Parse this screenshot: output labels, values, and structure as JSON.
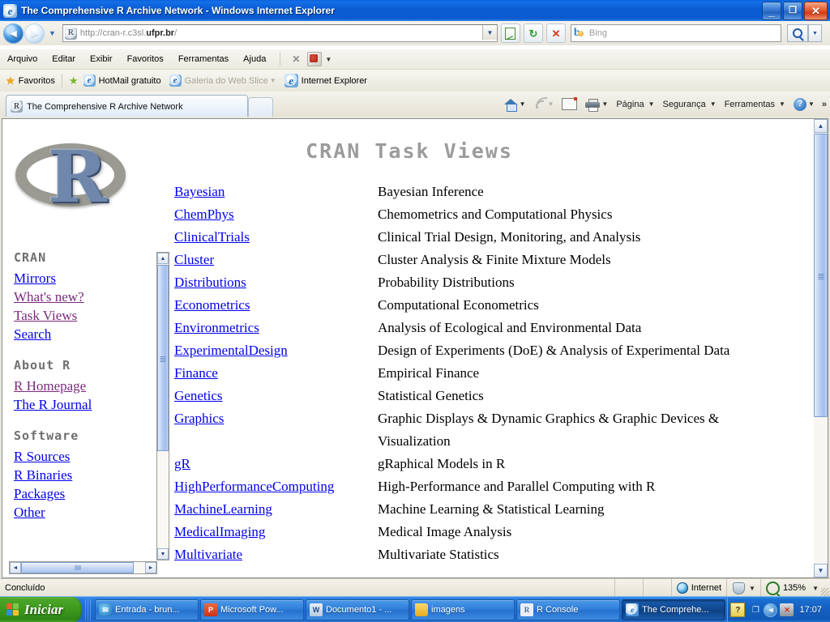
{
  "window": {
    "title": "The Comprehensive R Archive Network - Windows Internet Explorer",
    "app_icon": "internet-explorer-icon",
    "minimize": "_",
    "restore": "❐",
    "close": "✕"
  },
  "navbar": {
    "back_glyph": "◄",
    "forward_glyph": "►",
    "history_glyph": "▼",
    "address_value_prefix": "http://cran-r.c3sl.",
    "address_value_bold": "ufpr.br",
    "address_value_suffix": "/",
    "address_dropdown_glyph": "▼",
    "compat_icon": "compatibility-view-icon",
    "refresh_icon": "↻",
    "stop_icon": "✕",
    "search_engine": "Bing",
    "search_go_glyph": "🔍",
    "search_dropdown_glyph": "▼"
  },
  "menubar": {
    "items": [
      "Arquivo",
      "Editar",
      "Exibir",
      "Favoritos",
      "Ferramentas",
      "Ajuda"
    ],
    "close_x": "✕",
    "pdf_dropdown_glyph": "▼"
  },
  "favbar": {
    "favorites_label": "Favoritos",
    "add_glyph": "★",
    "items": [
      {
        "label": "HotMail gratuito",
        "dim": false,
        "dropdown": false
      },
      {
        "label": "Galeria do Web Slice",
        "dim": true,
        "dropdown": true
      },
      {
        "label": "Internet Explorer",
        "dim": false,
        "dropdown": false
      }
    ]
  },
  "tabs": {
    "active_tab_label": "The Comprehensive R Archive Network",
    "tab_icon": "r-site-icon",
    "new_tab_label": ""
  },
  "commandbar": {
    "home_label": "",
    "feeds_label": "",
    "mail_label": "",
    "print_label": "",
    "items": [
      "Página",
      "Segurança",
      "Ferramentas"
    ],
    "help_glyph": "?",
    "overflow_glyph": "»",
    "dropdown_glyph": "▼"
  },
  "page": {
    "logo_letter": "R",
    "sidebar": [
      {
        "heading": "CRAN",
        "links": [
          {
            "label": "Mirrors",
            "visited": false
          },
          {
            "label": "What's new?",
            "visited": true
          },
          {
            "label": "Task Views",
            "visited": true
          },
          {
            "label": "Search",
            "visited": false
          }
        ]
      },
      {
        "heading": "About R",
        "links": [
          {
            "label": "R Homepage",
            "visited": true
          },
          {
            "label": "The R Journal",
            "visited": false
          }
        ]
      },
      {
        "heading": "Software",
        "links": [
          {
            "label": "R Sources",
            "visited": false
          },
          {
            "label": "R Binaries",
            "visited": false
          },
          {
            "label": "Packages",
            "visited": false
          },
          {
            "label": "Other",
            "visited": false
          }
        ]
      }
    ],
    "title": "CRAN Task Views",
    "task_views": [
      {
        "name": "Bayesian",
        "description": "Bayesian Inference"
      },
      {
        "name": "ChemPhys",
        "description": "Chemometrics and Computational Physics"
      },
      {
        "name": "ClinicalTrials",
        "description": "Clinical Trial Design, Monitoring, and Analysis"
      },
      {
        "name": "Cluster",
        "description": "Cluster Analysis & Finite Mixture Models"
      },
      {
        "name": "Distributions",
        "description": "Probability Distributions"
      },
      {
        "name": "Econometrics",
        "description": "Computational Econometrics"
      },
      {
        "name": "Environmetrics",
        "description": "Analysis of Ecological and Environmental Data"
      },
      {
        "name": "ExperimentalDesign",
        "description": "Design of Experiments (DoE) & Analysis of Experimental Data"
      },
      {
        "name": "Finance",
        "description": "Empirical Finance"
      },
      {
        "name": "Genetics",
        "description": "Statistical Genetics"
      },
      {
        "name": "Graphics",
        "description": "Graphic Displays & Dynamic Graphics & Graphic Devices & Visualization"
      },
      {
        "name": "gR",
        "description": "gRaphical Models in R"
      },
      {
        "name": "HighPerformanceComputing",
        "description": "High-Performance and Parallel Computing with R"
      },
      {
        "name": "MachineLearning",
        "description": "Machine Learning & Statistical Learning"
      },
      {
        "name": "MedicalImaging",
        "description": "Medical Image Analysis"
      },
      {
        "name": "Multivariate",
        "description": "Multivariate Statistics"
      }
    ]
  },
  "statusbar": {
    "status": "Concluído",
    "zone": "Internet",
    "protected_mode_glyph": "",
    "zoom": "135%",
    "dropdown_glyph": "▼"
  },
  "taskbar": {
    "start_label": "Iniciar",
    "tasks": [
      {
        "label": "Entrada - brun...",
        "icon": "mail-icon",
        "active": false
      },
      {
        "label": "Microsoft Pow...",
        "icon": "powerpoint-icon",
        "active": false
      },
      {
        "label": "Documento1 - ...",
        "icon": "word-icon",
        "active": false
      },
      {
        "label": "imagens",
        "icon": "folder-icon",
        "active": false
      },
      {
        "label": "R Console",
        "icon": "r-console-icon",
        "active": false
      },
      {
        "label": "The Comprehe...",
        "icon": "internet-explorer-icon",
        "active": true
      }
    ],
    "tray": {
      "help_glyph": "?",
      "network_glyph": "❐",
      "expand_glyph": "◄",
      "clock": "17:07"
    }
  },
  "colors": {
    "title_blue": "#0a5ad0",
    "link_blue": "#0000ee",
    "link_visited": "#7d2a7d",
    "heading_gray": "#6f6f6f",
    "page_title_gray": "#9b9b9b",
    "taskbar_blue": "#1f6fd4",
    "start_green": "#3d9a1e"
  }
}
